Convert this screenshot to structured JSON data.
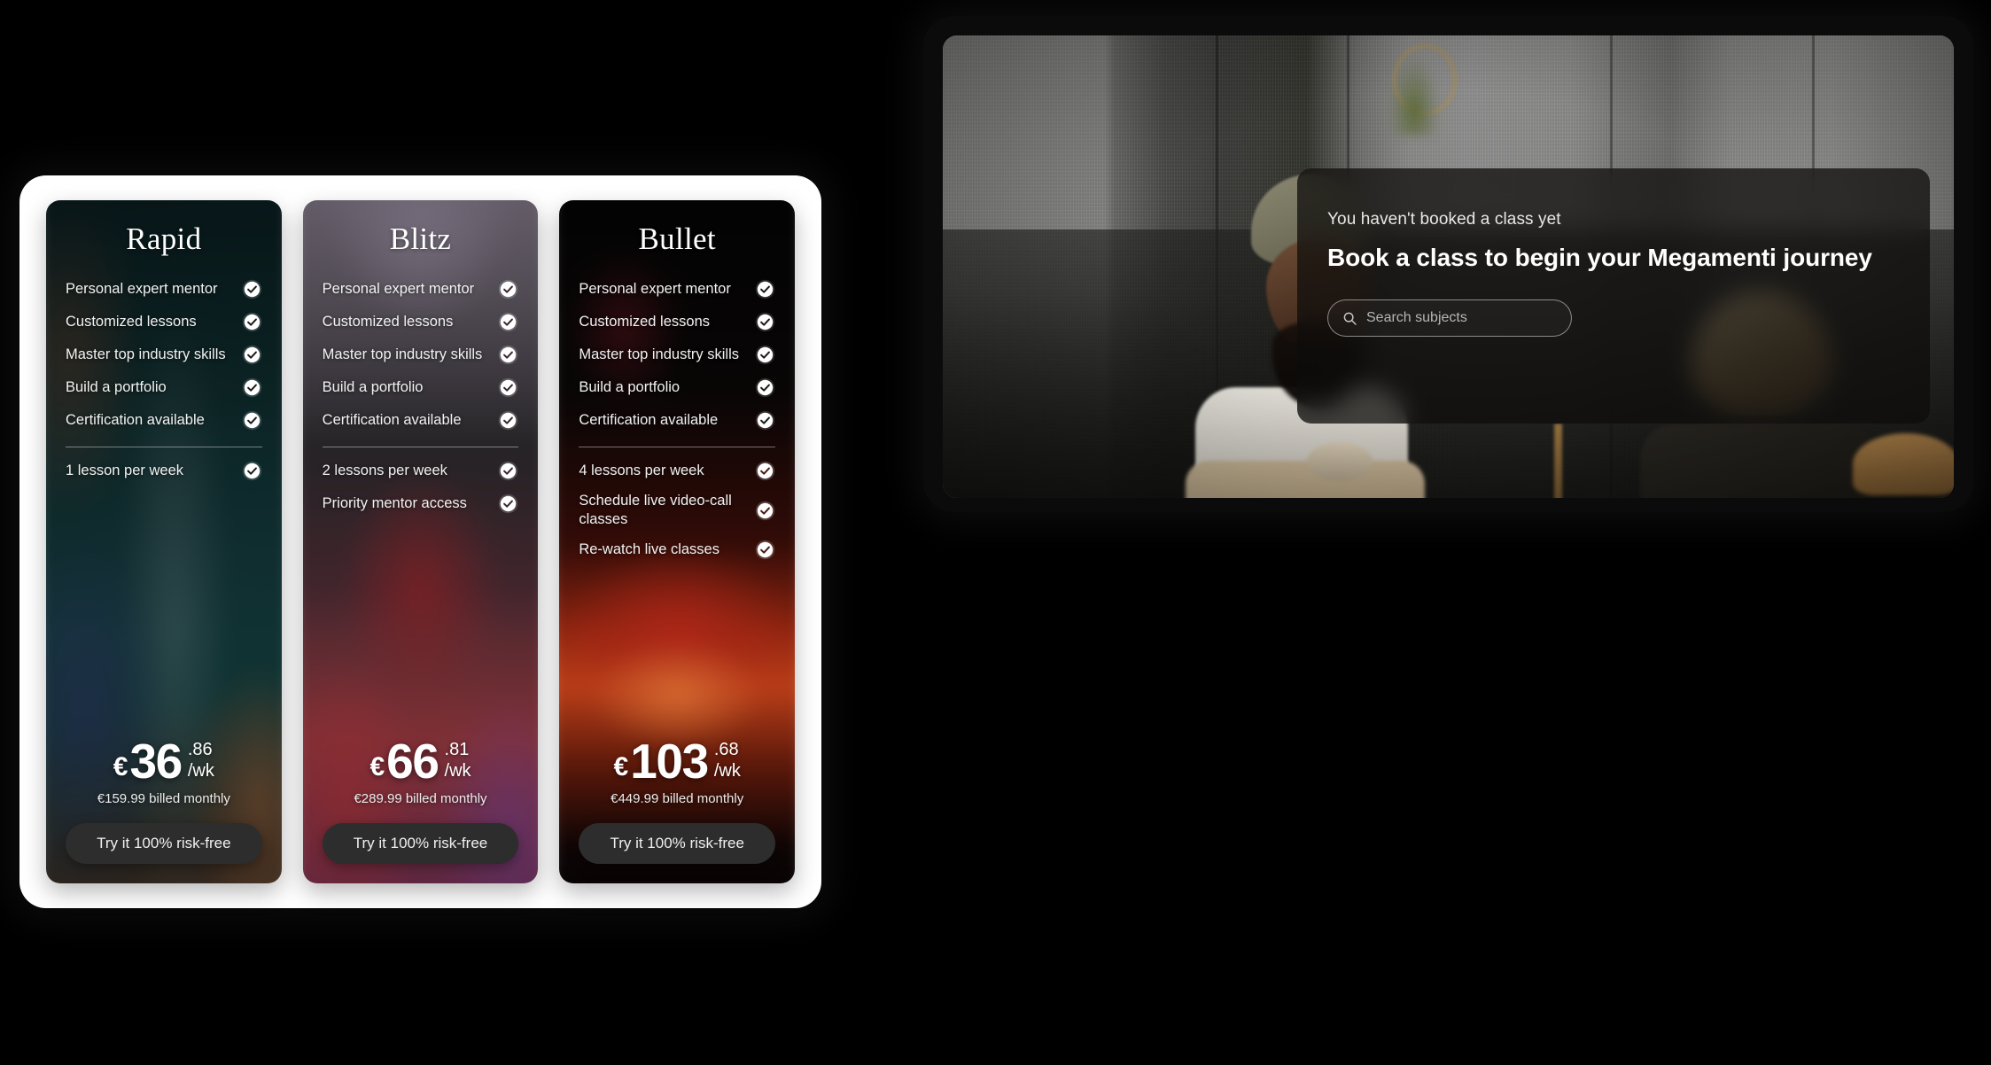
{
  "booking_panel": {
    "eyebrow": "You haven't booked a class yet",
    "title": "Book a class to begin your Megamenti journey",
    "search": {
      "placeholder": "Search subjects",
      "value": "",
      "icon": "search-icon"
    },
    "photo_alt": "Two students sitting against a concrete wall with laptops"
  },
  "pricing": {
    "check_icon": "check-circle-icon",
    "plans": [
      {
        "name": "Rapid",
        "base_features": [
          "Personal expert mentor",
          "Customized lessons",
          "Master top industry skills",
          "Build a portfolio",
          "Certification available"
        ],
        "extra_features": [
          "1 lesson per week"
        ],
        "price": {
          "currency": "€",
          "whole": "36",
          "cents": ".86",
          "period": "/wk"
        },
        "billed_note": "€159.99 billed monthly",
        "cta_label": "Try it 100% risk-free"
      },
      {
        "name": "Blitz",
        "base_features": [
          "Personal expert mentor",
          "Customized lessons",
          "Master top industry skills",
          "Build a portfolio",
          "Certification available"
        ],
        "extra_features": [
          "2 lessons per week",
          "Priority mentor access"
        ],
        "price": {
          "currency": "€",
          "whole": "66",
          "cents": ".81",
          "period": "/wk"
        },
        "billed_note": "€289.99 billed monthly",
        "cta_label": "Try it 100% risk-free"
      },
      {
        "name": "Bullet",
        "base_features": [
          "Personal expert mentor",
          "Customized lessons",
          "Master top industry skills",
          "Build a portfolio",
          "Certification available"
        ],
        "extra_features": [
          "4 lessons per week",
          "Schedule live video-call classes",
          "Re-watch live classes"
        ],
        "price": {
          "currency": "€",
          "whole": "103",
          "cents": ".68",
          "period": "/wk"
        },
        "billed_note": "€449.99 billed monthly",
        "cta_label": "Try it 100% risk-free"
      }
    ]
  },
  "colors": {
    "page_background": "#000000",
    "panel_background": "#ffffff",
    "cta_background": "#2d2d2d",
    "cta_text": "#f0f0f0",
    "feature_text": "#f2f2f2",
    "glass_overlay": "rgba(14,12,11,0.74)"
  }
}
